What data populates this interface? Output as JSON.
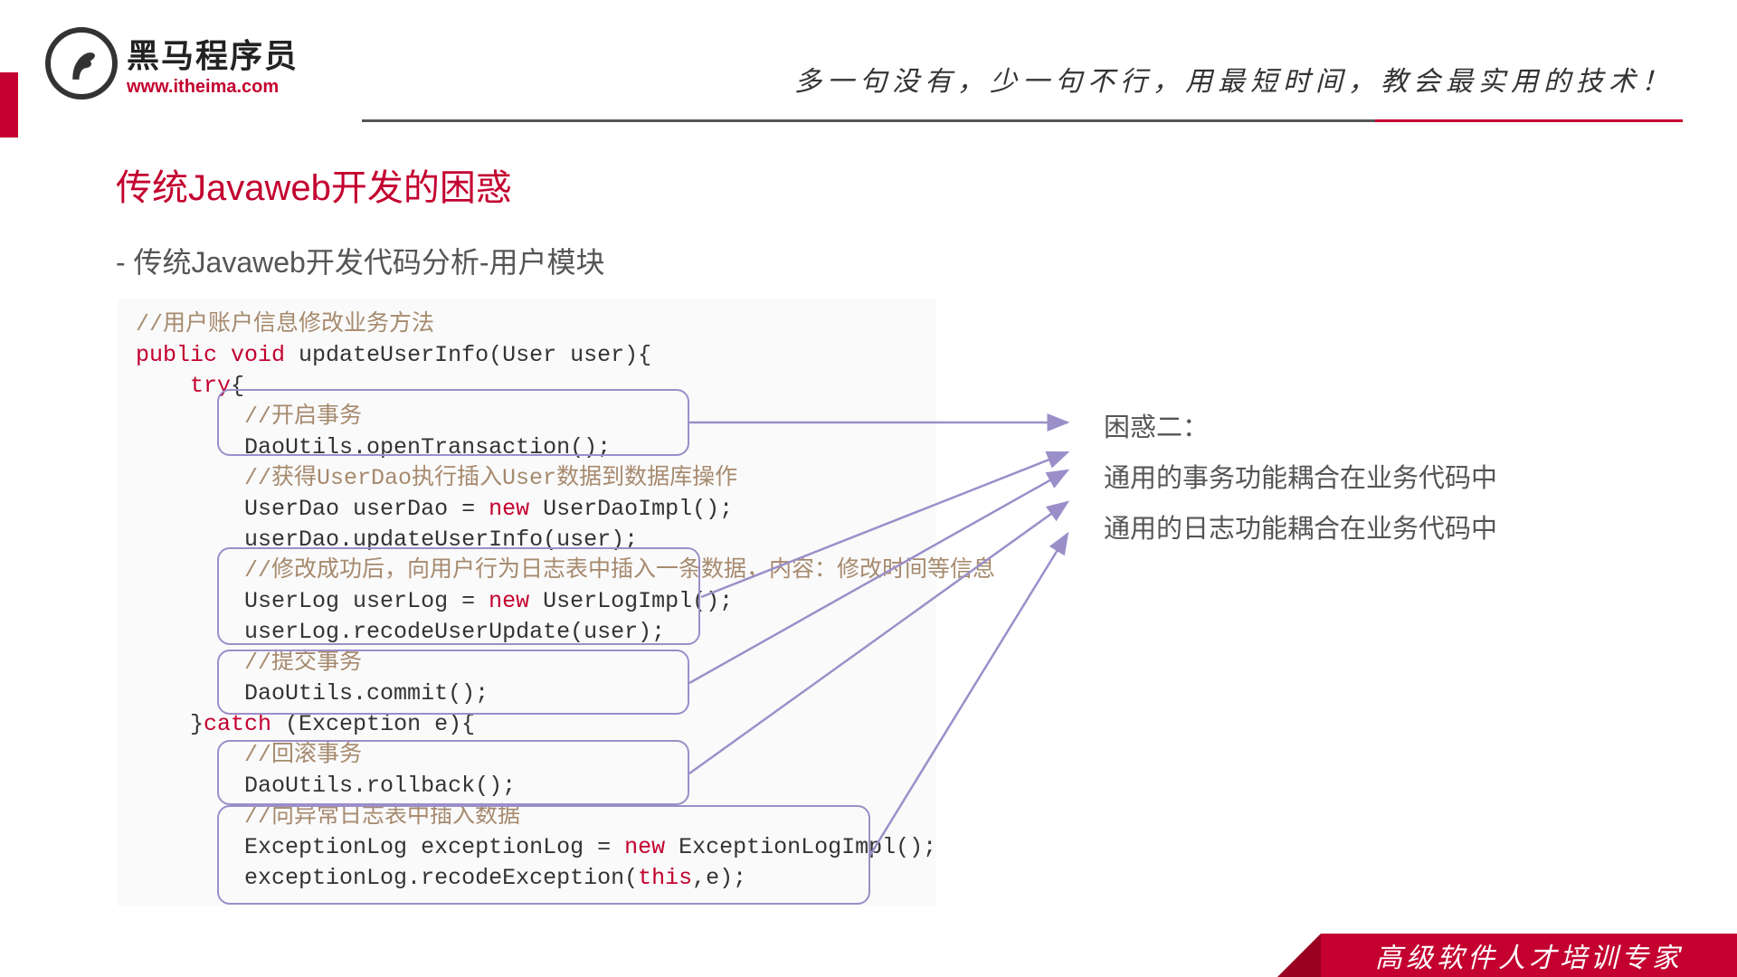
{
  "brand": {
    "name": "黑马程序员",
    "url": "www.itheima.com"
  },
  "slogan": "多一句没有，少一句不行，用最短时间，教会最实用的技术！",
  "title": "传统Javaweb开发的困惑",
  "subtitle": "- 传统Javaweb开发代码分析-用户模块",
  "code": {
    "c1": "//用户账户信息修改业务方法",
    "sig_pub": "public ",
    "sig_void": "void ",
    "sig_rest": "updateUserInfo(User user){",
    "try_kw": "try",
    "try_brace": "{",
    "c2": "//开启事务",
    "l1": "DaoUtils.openTransaction();",
    "c3": "//获得UserDao执行插入User数据到数据库操作",
    "l2a": "UserDao userDao = ",
    "l2new": "new ",
    "l2b": "UserDaoImpl();",
    "l3": "userDao.updateUserInfo(user);",
    "c4": "//修改成功后，向用户行为日志表中插入一条数据，内容：修改时间等信息",
    "l4a": "UserLog userLog = ",
    "l4new": "new ",
    "l4b": "UserLogImpl();",
    "l5": "userLog.recodeUserUpdate(user);",
    "c5": "//提交事务",
    "l6": "DaoUtils.commit();",
    "catch_brace": "}",
    "catch_kw": "catch ",
    "catch_rest": "(Exception e){",
    "c6": "//回滚事务",
    "l7": "DaoUtils.rollback();",
    "c7": "//向异常日志表中插入数据",
    "l8a": "ExceptionLog exceptionLog = ",
    "l8new": "new ",
    "l8b": "ExceptionLogImpl();",
    "l9a": "exceptionLog.recodeException(",
    "l9this": "this",
    "l9b": ",e);"
  },
  "confusion": {
    "heading": "困惑二：",
    "line1": "通用的事务功能耦合在业务代码中",
    "line2": "通用的日志功能耦合在业务代码中"
  },
  "footer": "高级软件人才培训专家"
}
